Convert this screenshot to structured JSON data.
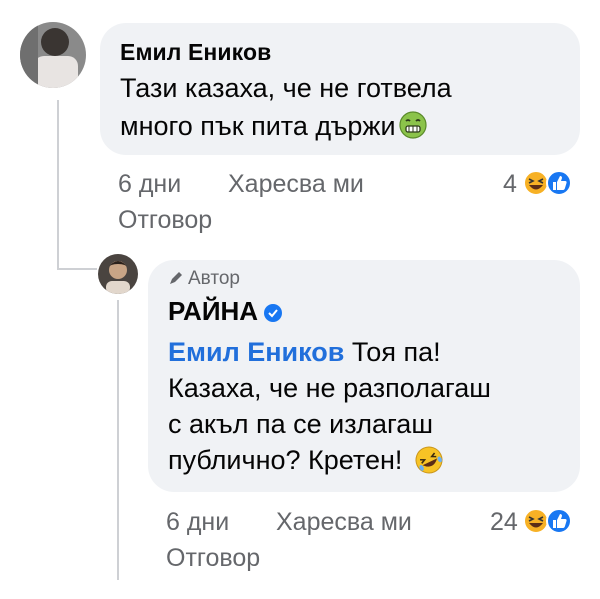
{
  "comment": {
    "author": "Емил Еников",
    "text_line1": "Тази казаха, че не готвела",
    "text_line2": "много пък пита държи",
    "emoji": "nauseated-face",
    "time": "6 дни",
    "like_label": "Харесва ми",
    "reply_label": "Отговор",
    "reaction_count": "4",
    "reaction_icons": [
      "haha-icon",
      "like-icon"
    ]
  },
  "reply": {
    "badge": "Автор",
    "author": "РАЙНА",
    "verified": true,
    "mention": "Емил Еников",
    "text_line1": "Тоя па!",
    "text_line2": "Казаха, че не разполагаш",
    "text_line3": "с акъл па се излагаш",
    "text_line4": "публично? Кретен!",
    "emoji": "rolling-on-floor-laughing",
    "time": "6 дни",
    "like_label": "Харесва ми",
    "reply_label": "Отговор",
    "reaction_count": "24",
    "reaction_icons": [
      "haha-icon",
      "like-icon"
    ]
  },
  "colors": {
    "bubble": "#f0f2f5",
    "meta_text": "#65676b",
    "link_blue": "#216fdb",
    "like_blue": "#1877f2",
    "haha_yellow": "#f7b125"
  }
}
